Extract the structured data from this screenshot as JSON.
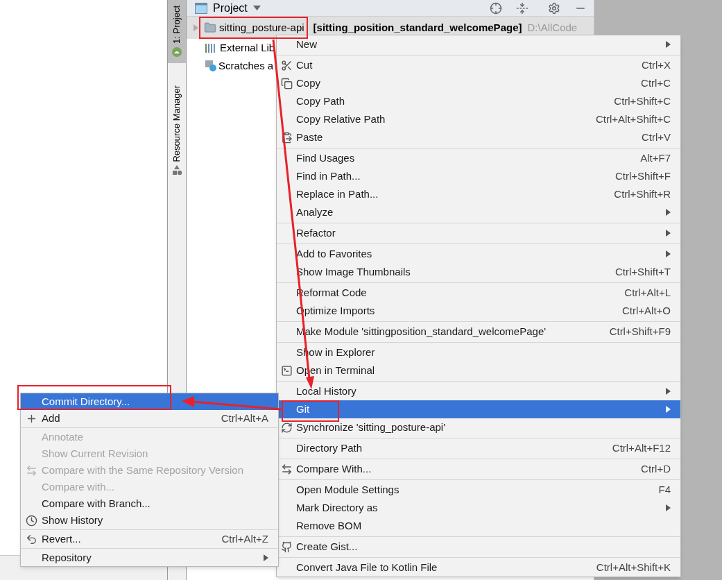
{
  "tool_strip": {
    "tabs": [
      {
        "label": "1: Project",
        "selected": true
      },
      {
        "label": "Resource Manager",
        "selected": false
      }
    ]
  },
  "project_panel": {
    "title": "Project",
    "tree": [
      {
        "name": "sitting_posture-api",
        "module": "[sitting_position_standard_welcomePage]",
        "path": "D:\\AllCode",
        "selected": true,
        "expanded": false
      },
      {
        "name": "External Lib",
        "selected": false
      },
      {
        "name": "Scratches a",
        "selected": false
      }
    ]
  },
  "context_menu": {
    "groups": [
      [
        {
          "label": "New",
          "submenu": true,
          "selected": false
        }
      ],
      [
        {
          "label": "Cut",
          "shortcut": "Ctrl+X",
          "submenu": false,
          "selected": false
        },
        {
          "label": "Copy",
          "shortcut": "Ctrl+C",
          "submenu": false,
          "selected": false
        },
        {
          "label": "Copy Path",
          "shortcut": "Ctrl+Shift+C",
          "submenu": false,
          "selected": false
        },
        {
          "label": "Copy Relative Path",
          "shortcut": "Ctrl+Alt+Shift+C",
          "submenu": false,
          "selected": false
        },
        {
          "label": "Paste",
          "shortcut": "Ctrl+V",
          "submenu": false,
          "selected": false
        }
      ],
      [
        {
          "label": "Find Usages",
          "shortcut": "Alt+F7",
          "submenu": false,
          "selected": false
        },
        {
          "label": "Find in Path...",
          "shortcut": "Ctrl+Shift+F",
          "submenu": false,
          "selected": false
        },
        {
          "label": "Replace in Path...",
          "shortcut": "Ctrl+Shift+R",
          "submenu": false,
          "selected": false
        },
        {
          "label": "Analyze",
          "submenu": true,
          "selected": false
        }
      ],
      [
        {
          "label": "Refactor",
          "submenu": true,
          "selected": false
        }
      ],
      [
        {
          "label": "Add to Favorites",
          "submenu": true,
          "selected": false
        },
        {
          "label": "Show Image Thumbnails",
          "shortcut": "Ctrl+Shift+T",
          "submenu": false,
          "selected": false
        }
      ],
      [
        {
          "label": "Reformat Code",
          "shortcut": "Ctrl+Alt+L",
          "submenu": false,
          "selected": false
        },
        {
          "label": "Optimize Imports",
          "shortcut": "Ctrl+Alt+O",
          "submenu": false,
          "selected": false
        }
      ],
      [
        {
          "label": "Make Module 'sittingposition_standard_welcomePage'",
          "shortcut": "Ctrl+Shift+F9",
          "submenu": false,
          "selected": false
        }
      ],
      [
        {
          "label": "Show in Explorer",
          "submenu": false,
          "selected": false
        },
        {
          "label": "Open in Terminal",
          "submenu": false,
          "selected": false
        }
      ],
      [
        {
          "label": "Local History",
          "submenu": true,
          "selected": false
        },
        {
          "label": "Git",
          "submenu": true,
          "selected": true
        },
        {
          "label": "Synchronize 'sitting_posture-api'",
          "submenu": false,
          "selected": false
        }
      ],
      [
        {
          "label": "Directory Path",
          "shortcut": "Ctrl+Alt+F12",
          "submenu": false,
          "selected": false
        }
      ],
      [
        {
          "label": "Compare With...",
          "shortcut": "Ctrl+D",
          "submenu": false,
          "selected": false
        }
      ],
      [
        {
          "label": "Open Module Settings",
          "shortcut": "F4",
          "submenu": false,
          "selected": false
        },
        {
          "label": "Mark Directory as",
          "submenu": true,
          "selected": false
        },
        {
          "label": "Remove BOM",
          "submenu": false,
          "selected": false
        }
      ],
      [
        {
          "label": "Create Gist...",
          "submenu": false,
          "selected": false
        }
      ],
      [
        {
          "label": "Convert Java File to Kotlin File",
          "shortcut": "Ctrl+Alt+Shift+K",
          "submenu": false,
          "selected": false
        }
      ]
    ]
  },
  "git_submenu": {
    "groups": [
      [
        {
          "label": "Commit Directory...",
          "submenu": false,
          "selected": true,
          "disabled": false
        },
        {
          "label": "Add",
          "shortcut": "Ctrl+Alt+A",
          "submenu": false,
          "selected": false,
          "disabled": false
        }
      ],
      [
        {
          "label": "Annotate",
          "submenu": false,
          "selected": false,
          "disabled": true
        },
        {
          "label": "Show Current Revision",
          "submenu": false,
          "selected": false,
          "disabled": true
        },
        {
          "label": "Compare with the Same Repository Version",
          "submenu": false,
          "selected": false,
          "disabled": true
        },
        {
          "label": "Compare with...",
          "submenu": false,
          "selected": false,
          "disabled": true
        },
        {
          "label": "Compare with Branch...",
          "submenu": false,
          "selected": false,
          "disabled": false
        },
        {
          "label": "Show History",
          "submenu": false,
          "selected": false,
          "disabled": false
        }
      ],
      [
        {
          "label": "Revert...",
          "shortcut": "Ctrl+Alt+Z",
          "submenu": false,
          "selected": false,
          "disabled": false
        }
      ],
      [
        {
          "label": "Repository",
          "submenu": true,
          "selected": false,
          "disabled": false
        }
      ]
    ]
  }
}
